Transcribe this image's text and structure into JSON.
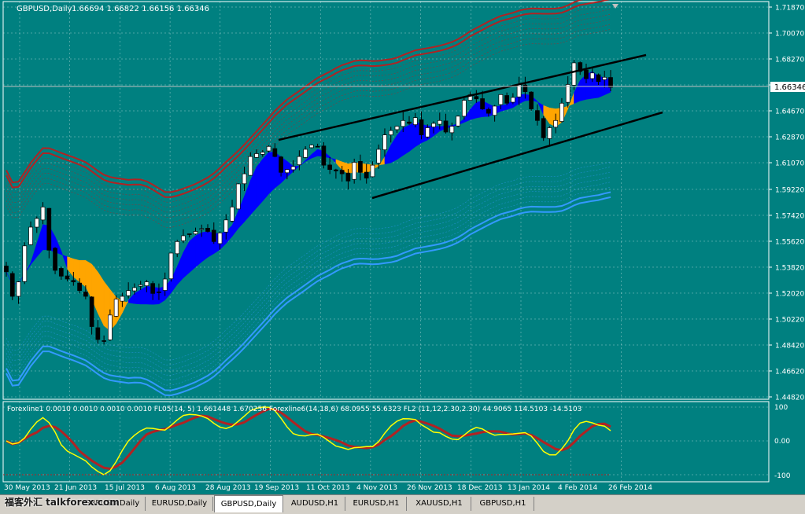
{
  "colors": {
    "background": "#008080",
    "grid": "#ffffff",
    "bull_candle": "#ffffff",
    "bear_candle": "#000000",
    "ribbon_up": "#0000ff",
    "ribbon_down": "#ffa500",
    "upper_band": "#b22222",
    "lower_band": "#3399ff",
    "osc_yellow": "#ffff00",
    "osc_red": "#b22222",
    "channel": "#000000",
    "price_label_bg": "#ffffff"
  },
  "header": {
    "symbol": "GBPUSD,Daily",
    "ohlc": "1.66694 1.66822 1.66156 1.66346",
    "arrow_icon": "triangle-down-icon"
  },
  "price_axis": {
    "labels": [
      "1.71870",
      "1.70070",
      "1.68270",
      "1.66470",
      "1.64670",
      "1.62870",
      "1.61070",
      "1.59220",
      "1.57420",
      "1.55620",
      "1.53820",
      "1.52020",
      "1.50220",
      "1.48420",
      "1.46620",
      "1.44820"
    ],
    "current_price": "1.66346"
  },
  "indicator_label": "Forexline1 0.0010 0.0010 0.0010 0.0010   FL05(14, 5)  1.661448  1.670256   Forexline6(14,18,6) 68.0955 55.6323   FL2 (11,12,2.30,2.30) 44.9065 114.5103 -14.5103",
  "indicator_axis": [
    "100",
    "0.00",
    "-100"
  ],
  "time_axis": [
    "30 May 2013",
    "21 Jun 2013",
    "15 Jul 2013",
    "6 Aug 2013",
    "28 Aug 2013",
    "19 Sep 2013",
    "11 Oct 2013",
    "4 Nov 2013",
    "26 Nov 2013",
    "18 Dec 2013",
    "13 Jan 2014",
    "4 Feb 2014",
    "26 Feb 2014"
  ],
  "tabs": [
    "GBPUSD,Daily",
    "EURUSD,Daily",
    "GBPUSD,Daily",
    "AUDUSD,H1",
    "EURUSD,H1",
    "XAUUSD,H1",
    "GBPUSD,H1"
  ],
  "active_tab": 2,
  "watermark": "福客外汇 talkforex.com",
  "chart_data": {
    "type": "candlestick",
    "symbol": "GBPUSD",
    "timeframe": "Daily",
    "y_range": [
      1.44,
      1.72
    ],
    "current_price": 1.66346,
    "dates": [
      "30 May 2013",
      "21 Jun 2013",
      "15 Jul 2013",
      "6 Aug 2013",
      "28 Aug 2013",
      "19 Sep 2013",
      "11 Oct 2013",
      "4 Nov 2013",
      "26 Nov 2013",
      "18 Dec 2013",
      "13 Jan 2014",
      "4 Feb 2014",
      "26 Feb 2014"
    ],
    "close_trace": [
      1.535,
      1.518,
      1.528,
      1.553,
      1.566,
      1.572,
      1.58,
      1.55,
      1.536,
      1.532,
      1.53,
      1.528,
      1.522,
      1.518,
      1.497,
      1.488,
      1.487,
      1.505,
      1.516,
      1.518,
      1.522,
      1.524,
      1.526,
      1.528,
      1.52,
      1.521,
      1.53,
      1.548,
      1.556,
      1.56,
      1.561,
      1.563,
      1.565,
      1.563,
      1.556,
      1.562,
      1.571,
      1.58,
      1.596,
      1.603,
      1.615,
      1.617,
      1.618,
      1.622,
      1.615,
      1.604,
      1.606,
      1.608,
      1.615,
      1.62,
      1.623,
      1.622,
      1.609,
      1.606,
      1.605,
      1.603,
      1.598,
      1.611,
      1.604,
      1.6,
      1.609,
      1.62,
      1.63,
      1.633,
      1.636,
      1.64,
      1.638,
      1.642,
      1.63,
      1.635,
      1.638,
      1.64,
      1.632,
      1.636,
      1.643,
      1.654,
      1.658,
      1.655,
      1.648,
      1.645,
      1.65,
      1.658,
      1.652,
      1.656,
      1.665,
      1.66,
      1.648,
      1.64,
      1.628,
      1.635,
      1.64,
      1.652,
      1.665,
      1.68,
      1.674,
      1.669,
      1.673,
      1.667,
      1.67,
      1.663
    ]
  }
}
